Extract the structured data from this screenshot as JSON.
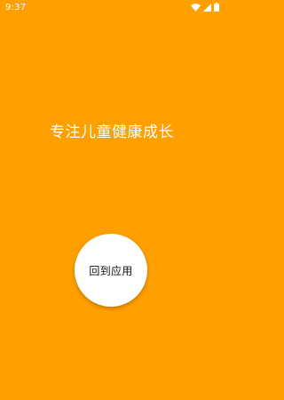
{
  "status_bar": {
    "time": "9:37",
    "icons": [
      "wifi-icon",
      "signal-icon",
      "battery-icon"
    ]
  },
  "main": {
    "slogan": "专注儿童健康成长",
    "return_button_label": "回到应用"
  },
  "colors": {
    "background": "#ff9f00",
    "button_background": "#ffffff",
    "slogan_text": "#ffffff",
    "button_text": "#111111"
  }
}
